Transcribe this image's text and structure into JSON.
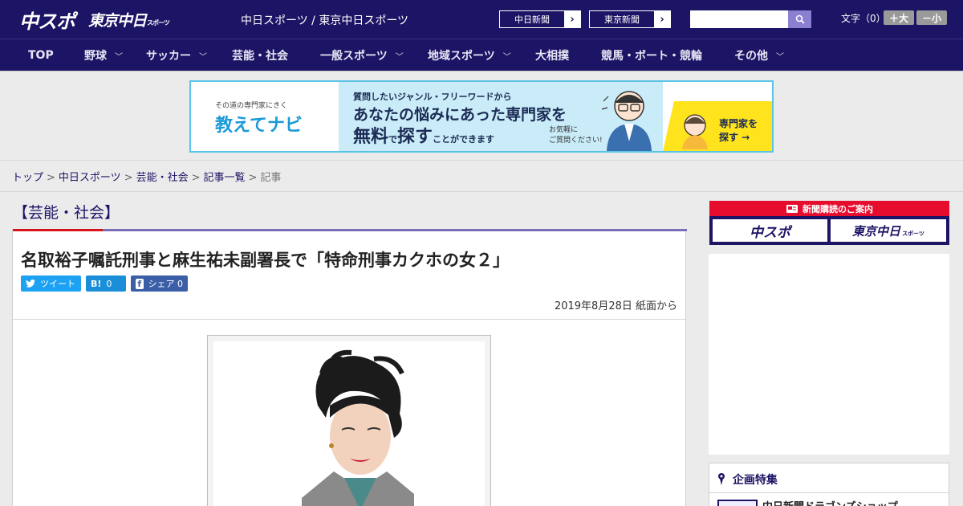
{
  "header": {
    "logo_chuspo": "中スポ",
    "logo_tokyo": "東京中日",
    "logo_tokyo_small": "スポーツ",
    "site_links": "中日スポーツ / 東京中日スポーツ",
    "newspaper_links": [
      {
        "label": "中日新聞",
        "arrow": "›"
      },
      {
        "label": "東京新聞",
        "arrow": "›"
      }
    ],
    "font_size_label": "文字（0）",
    "font_larger": "＋大",
    "font_smaller": "－小"
  },
  "nav": {
    "items": [
      {
        "label": "TOP",
        "chevron": ""
      },
      {
        "label": "野球",
        "chevron": "﹀"
      },
      {
        "label": "サッカー",
        "chevron": "﹀"
      },
      {
        "label": "芸能・社会",
        "chevron": ""
      },
      {
        "label": "一般スポーツ",
        "chevron": "﹀"
      },
      {
        "label": "地域スポーツ",
        "chevron": "﹀"
      },
      {
        "label": "大相撲",
        "chevron": ""
      },
      {
        "label": "競馬・ボート・競輪",
        "chevron": ""
      },
      {
        "label": "その他",
        "chevron": "﹀"
      }
    ]
  },
  "banner": {
    "tagline": "その道の専門家にきく",
    "logo": "教えてナビ",
    "line1": "質問したいジャンル・フリーワードから",
    "line2": "あなたの悩みにあった専門家を",
    "line3_a": "無料",
    "line3_b": "で",
    "line3_c": "探す",
    "line3_d": "ことができます",
    "note_1": "お気軽に",
    "note_2": "ご質問ください!",
    "cta_1": "専門家を",
    "cta_2": "探す →"
  },
  "breadcrumb": {
    "items": [
      "トップ",
      "中日スポーツ",
      "芸能・社会",
      "記事一覧"
    ],
    "current": "記事",
    "separator": ">"
  },
  "article": {
    "category": "【芸能・社会】",
    "headline": "名取裕子嘱託刑事と麻生祐未副署長で「特命刑事カクホの女２」",
    "share": {
      "tweet_icon": "t",
      "tweet_label": "ツイート",
      "hatena_icon": "B!",
      "hatena_count": "0",
      "fb_icon": "f",
      "fb_label": "シェア",
      "fb_count": "0"
    },
    "date": "2019年8月28日 紙面から"
  },
  "sidebar": {
    "subscription_title": "新聞購読のご案内",
    "sub_logo1": "中スポ",
    "sub_logo2": "東京中日",
    "sub_logo2_small": "スポーツ",
    "special_title": "企画特集",
    "special_link": "中日新聞ドラゴンズショップ"
  },
  "colors": {
    "brand_navy": "#1c1464",
    "accent_red": "#d7131c",
    "twitter": "#1da1f2",
    "hatena": "#1b8ed9",
    "facebook": "#3b5fa6"
  }
}
